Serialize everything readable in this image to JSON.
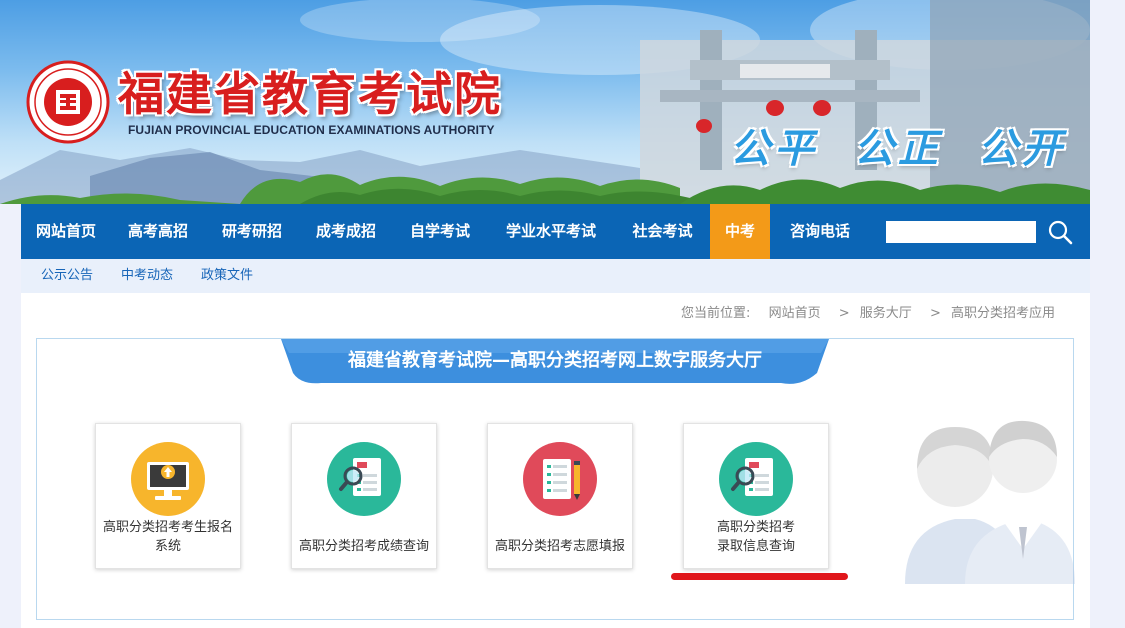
{
  "banner": {
    "title": "福建省教育考试院",
    "subtitle": "FUJIAN PROVINCIAL EDUCATION EXAMINATIONS AUTHORITY",
    "slogan": "公平  公正  公开",
    "seal_text": "福建省教育考试院"
  },
  "nav": {
    "items": [
      {
        "label": "网站首页"
      },
      {
        "label": "高考高招"
      },
      {
        "label": "研考研招"
      },
      {
        "label": "成考成招"
      },
      {
        "label": "自学考试"
      },
      {
        "label": "学业水平考试"
      },
      {
        "label": "社会考试"
      },
      {
        "label": "中考",
        "active": true
      },
      {
        "label": "咨询电话"
      }
    ],
    "search": {
      "value": "",
      "icon": "search-icon"
    }
  },
  "sub_nav": {
    "items": [
      {
        "label": "公示公告"
      },
      {
        "label": "中考动态"
      },
      {
        "label": "政策文件"
      }
    ]
  },
  "breadcrumb": {
    "prefix": "您当前位置:",
    "items": [
      "网站首页",
      "服务大厅",
      "高职分类招考应用"
    ],
    "separator": ">"
  },
  "hall": {
    "title": "福建省教育考试院—高职分类招考网上数字服务大厅"
  },
  "services": [
    {
      "label": "高职分类招考考生报名\n系统",
      "icon": "monitor-upload-icon",
      "color": "#f7b52c"
    },
    {
      "label": "高职分类招考成绩查询",
      "icon": "score-search-icon",
      "color": "#2ab89a"
    },
    {
      "label": "高职分类招考志愿填报",
      "icon": "form-pencil-icon",
      "color": "#e04a5a"
    },
    {
      "label": "高职分类招考\n录取信息查询",
      "icon": "score-search-icon",
      "color": "#2ab89a",
      "highlighted": true
    }
  ],
  "colors": {
    "nav_bg": "#0b65b5",
    "nav_active": "#f39a18",
    "subnav_text": "#1765b8",
    "title_red": "#d81e1e",
    "highlight": "#e0161b"
  }
}
